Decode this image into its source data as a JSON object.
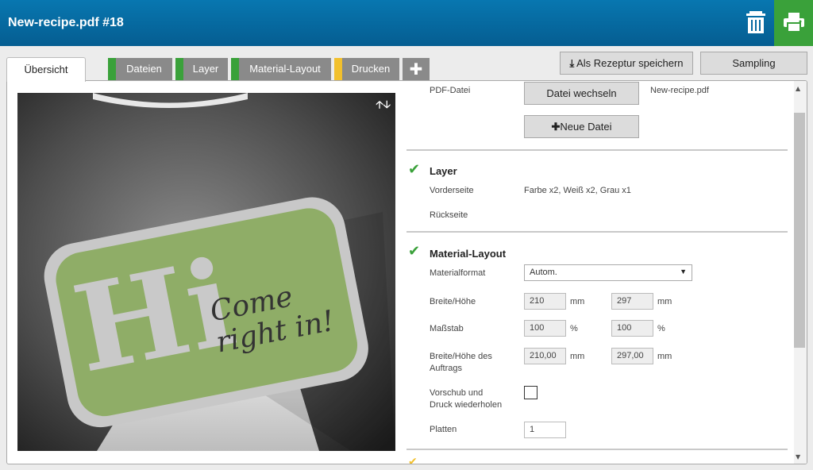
{
  "header": {
    "title": "New-recipe.pdf #18"
  },
  "tabs": [
    {
      "label": "Übersicht",
      "active": true
    },
    {
      "label": "Dateien",
      "stripe": "#3aa13a"
    },
    {
      "label": "Layer",
      "stripe": "#3aa13a"
    },
    {
      "label": "Material-Layout",
      "stripe": "#3aa13a"
    },
    {
      "label": "Drucken",
      "stripe": "#f2c02d"
    }
  ],
  "tab_add_icon": "plus-icon",
  "toolbar": {
    "save_recipe": "Als Rezeptur speichern",
    "sampling": "Sampling"
  },
  "files": {
    "pdf_label": "PDF-Datei",
    "change_button": "Datei wechseln",
    "filename": "New-recipe.pdf",
    "new_button": "Neue Datei"
  },
  "layer": {
    "title": "Layer",
    "front_label": "Vorderseite",
    "front_value": "Farbe x2, Weiß x2, Grau x1",
    "back_label": "Rückseite"
  },
  "material": {
    "title": "Material-Layout",
    "format_label": "Materialformat",
    "format_value": "Autom.",
    "size_label": "Breite/Höhe",
    "width": "210",
    "height": "297",
    "unit_mm": "mm",
    "scale_label": "Maßstab",
    "scale_x": "100",
    "scale_y": "100",
    "unit_pct": "%",
    "job_size_label_1": "Breite/Höhe des",
    "job_size_label_2": "Auftrags",
    "job_width": "210,00",
    "job_height": "297,00",
    "repeat_label_1": "Vorschub und",
    "repeat_label_2": "Druck wiederholen",
    "plates_label": "Platten",
    "plates_value": "1"
  },
  "preview": {
    "big_text": "Hi",
    "script_1": "Come",
    "script_2": "right in!"
  },
  "colors": {
    "header": "#0669a1",
    "accent_green": "#3aa13a",
    "accent_yellow": "#f2c02d",
    "sign_green": "#8fad67"
  }
}
